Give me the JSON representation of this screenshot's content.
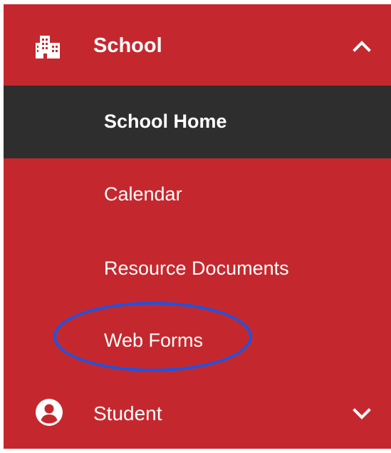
{
  "menu": {
    "school": {
      "label": "School",
      "icon": "school-building-icon",
      "expand_icon": "chevron-up-icon",
      "items": [
        {
          "label": "School Home",
          "active": true
        },
        {
          "label": "Calendar"
        },
        {
          "label": "Resource Documents"
        },
        {
          "label": "Web Forms",
          "highlighted": true
        }
      ]
    },
    "student": {
      "label": "Student",
      "icon": "user-circle-icon",
      "expand_icon": "chevron-down-icon"
    }
  },
  "colors": {
    "menu_background": "#c4282e",
    "active_background": "#2e2e2e",
    "text": "#ffffff",
    "annotation": "#1a55e6"
  }
}
